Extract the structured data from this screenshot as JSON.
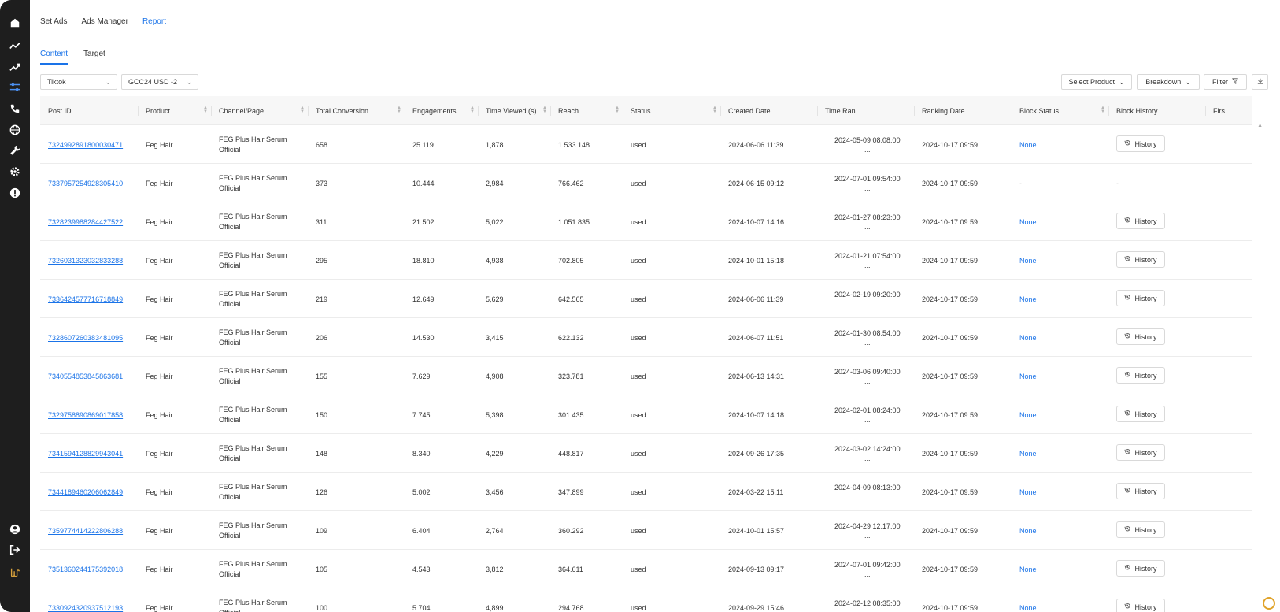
{
  "tabs_top": [
    {
      "label": "Set Ads",
      "active": false
    },
    {
      "label": "Ads Manager",
      "active": false
    },
    {
      "label": "Report",
      "active": true
    }
  ],
  "tabs_sub": [
    {
      "label": "Content",
      "active": true
    },
    {
      "label": "Target",
      "active": false
    }
  ],
  "filters": {
    "platform": "Tiktok",
    "account": "GCC24 USD -2",
    "select_product": "Select Product",
    "breakdown": "Breakdown",
    "filter": "Filter"
  },
  "columns": [
    "Post ID",
    "Product",
    "Channel/Page",
    "Total Conversion",
    "Engagements",
    "Time Viewed (s)",
    "Reach",
    "Status",
    "Created Date",
    "Time Ran",
    "Ranking Date",
    "Block Status",
    "Block History",
    "Firs"
  ],
  "history_label": "History",
  "channel_line1": "FEG Plus Hair Serum",
  "channel_line2": "Official",
  "time_ran_suffix": "...",
  "rows": [
    {
      "post_id": "7324992891800030471",
      "product": "Feg Hair",
      "conv": "658",
      "eng": "25.119",
      "tv": "1,878",
      "reach": "1.533.148",
      "status": "used",
      "created": "2024-06-06 11:39",
      "ran": "2024-05-09 08:08:00",
      "rank": "2024-10-17 09:59",
      "block": "None",
      "hist": true
    },
    {
      "post_id": "7337957254928305410",
      "product": "Feg Hair",
      "conv": "373",
      "eng": "10.444",
      "tv": "2,984",
      "reach": "766.462",
      "status": "used",
      "created": "2024-06-15 09:12",
      "ran": "2024-07-01 09:54:00",
      "rank": "2024-10-17 09:59",
      "block": "-",
      "hist": false,
      "hist_text": "-"
    },
    {
      "post_id": "7328239988284427522",
      "product": "Feg Hair",
      "conv": "311",
      "eng": "21.502",
      "tv": "5,022",
      "reach": "1.051.835",
      "status": "used",
      "created": "2024-10-07 14:16",
      "ran": "2024-01-27 08:23:00",
      "rank": "2024-10-17 09:59",
      "block": "None",
      "hist": true
    },
    {
      "post_id": "7326031323032833288",
      "product": "Feg Hair",
      "conv": "295",
      "eng": "18.810",
      "tv": "4,938",
      "reach": "702.805",
      "status": "used",
      "created": "2024-10-01 15:18",
      "ran": "2024-01-21 07:54:00",
      "rank": "2024-10-17 09:59",
      "block": "None",
      "hist": true
    },
    {
      "post_id": "7336424577716718849",
      "product": "Feg Hair",
      "conv": "219",
      "eng": "12.649",
      "tv": "5,629",
      "reach": "642.565",
      "status": "used",
      "created": "2024-06-06 11:39",
      "ran": "2024-02-19 09:20:00",
      "rank": "2024-10-17 09:59",
      "block": "None",
      "hist": true
    },
    {
      "post_id": "7328607260383481095",
      "product": "Feg Hair",
      "conv": "206",
      "eng": "14.530",
      "tv": "3,415",
      "reach": "622.132",
      "status": "used",
      "created": "2024-06-07 11:51",
      "ran": "2024-01-30 08:54:00",
      "rank": "2024-10-17 09:59",
      "block": "None",
      "hist": true
    },
    {
      "post_id": "7340554853845863681",
      "product": "Feg Hair",
      "conv": "155",
      "eng": "7.629",
      "tv": "4,908",
      "reach": "323.781",
      "status": "used",
      "created": "2024-06-13 14:31",
      "ran": "2024-03-06 09:40:00",
      "rank": "2024-10-17 09:59",
      "block": "None",
      "hist": true
    },
    {
      "post_id": "7329758890869017858",
      "product": "Feg Hair",
      "conv": "150",
      "eng": "7.745",
      "tv": "5,398",
      "reach": "301.435",
      "status": "used",
      "created": "2024-10-07 14:18",
      "ran": "2024-02-01 08:24:00",
      "rank": "2024-10-17 09:59",
      "block": "None",
      "hist": true
    },
    {
      "post_id": "7341594128829943041",
      "product": "Feg Hair",
      "conv": "148",
      "eng": "8.340",
      "tv": "4,229",
      "reach": "448.817",
      "status": "used",
      "created": "2024-09-26 17:35",
      "ran": "2024-03-02 14:24:00",
      "rank": "2024-10-17 09:59",
      "block": "None",
      "hist": true
    },
    {
      "post_id": "7344189460206062849",
      "product": "Feg Hair",
      "conv": "126",
      "eng": "5.002",
      "tv": "3,456",
      "reach": "347.899",
      "status": "used",
      "created": "2024-03-22 15:11",
      "ran": "2024-04-09 08:13:00",
      "rank": "2024-10-17 09:59",
      "block": "None",
      "hist": true
    },
    {
      "post_id": "7359774414222806288",
      "product": "Feg Hair",
      "conv": "109",
      "eng": "6.404",
      "tv": "2,764",
      "reach": "360.292",
      "status": "used",
      "created": "2024-10-01 15:57",
      "ran": "2024-04-29 12:17:00",
      "rank": "2024-10-17 09:59",
      "block": "None",
      "hist": true
    },
    {
      "post_id": "7351360244175392018",
      "product": "Feg Hair",
      "conv": "105",
      "eng": "4.543",
      "tv": "3,812",
      "reach": "364.611",
      "status": "used",
      "created": "2024-09-13 09:17",
      "ran": "2024-07-01 09:42:00",
      "rank": "2024-10-17 09:59",
      "block": "None",
      "hist": true
    },
    {
      "post_id": "7330924320937512193",
      "product": "Feg Hair",
      "conv": "100",
      "eng": "5.704",
      "tv": "4,899",
      "reach": "294.768",
      "status": "used",
      "created": "2024-09-29 15:46",
      "ran": "2024-02-12 08:35:00",
      "rank": "2024-10-17 09:59",
      "block": "None",
      "hist": true
    }
  ]
}
